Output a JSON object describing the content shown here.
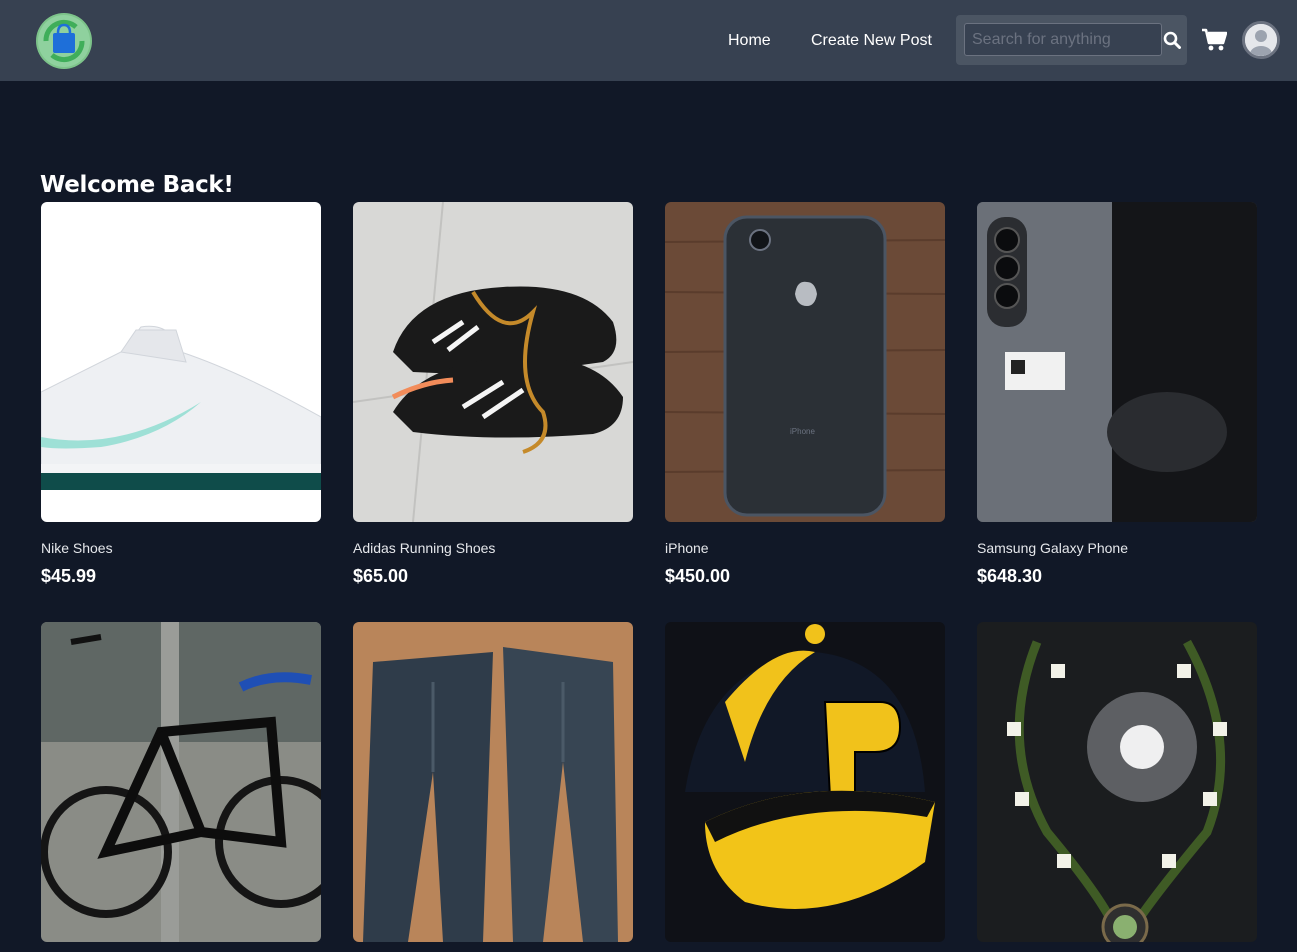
{
  "nav": {
    "links": [
      {
        "label": "Home"
      },
      {
        "label": "Create New Post"
      }
    ],
    "search": {
      "placeholder": "Search for anything",
      "value": ""
    },
    "icons": {
      "logo": "shopping-bag-recycle-logo",
      "search": "search-icon",
      "cart": "cart-icon",
      "avatar": "user-avatar-icon"
    }
  },
  "main": {
    "heading": "Welcome Back!",
    "products": [
      {
        "name": "Nike Shoes",
        "price": "$45.99",
        "image": "nike-shoe-photo"
      },
      {
        "name": "Adidas Running Shoes",
        "price": "$65.00",
        "image": "adidas-shoes-photo"
      },
      {
        "name": "iPhone",
        "price": "$450.00",
        "image": "iphone-photo"
      },
      {
        "name": "Samsung Galaxy Phone",
        "price": "$648.30",
        "image": "samsung-phone-photo"
      },
      {
        "name": "",
        "price": "",
        "image": "bicycle-photo"
      },
      {
        "name": "",
        "price": "",
        "image": "jeans-photo"
      },
      {
        "name": "",
        "price": "",
        "image": "penguins-cap-photo"
      },
      {
        "name": "",
        "price": "",
        "image": "beaded-necklace-photo"
      }
    ]
  },
  "colors": {
    "background": "#111827",
    "navbar": "#374151",
    "search_bg": "#4b5563",
    "text": "#ffffff"
  }
}
